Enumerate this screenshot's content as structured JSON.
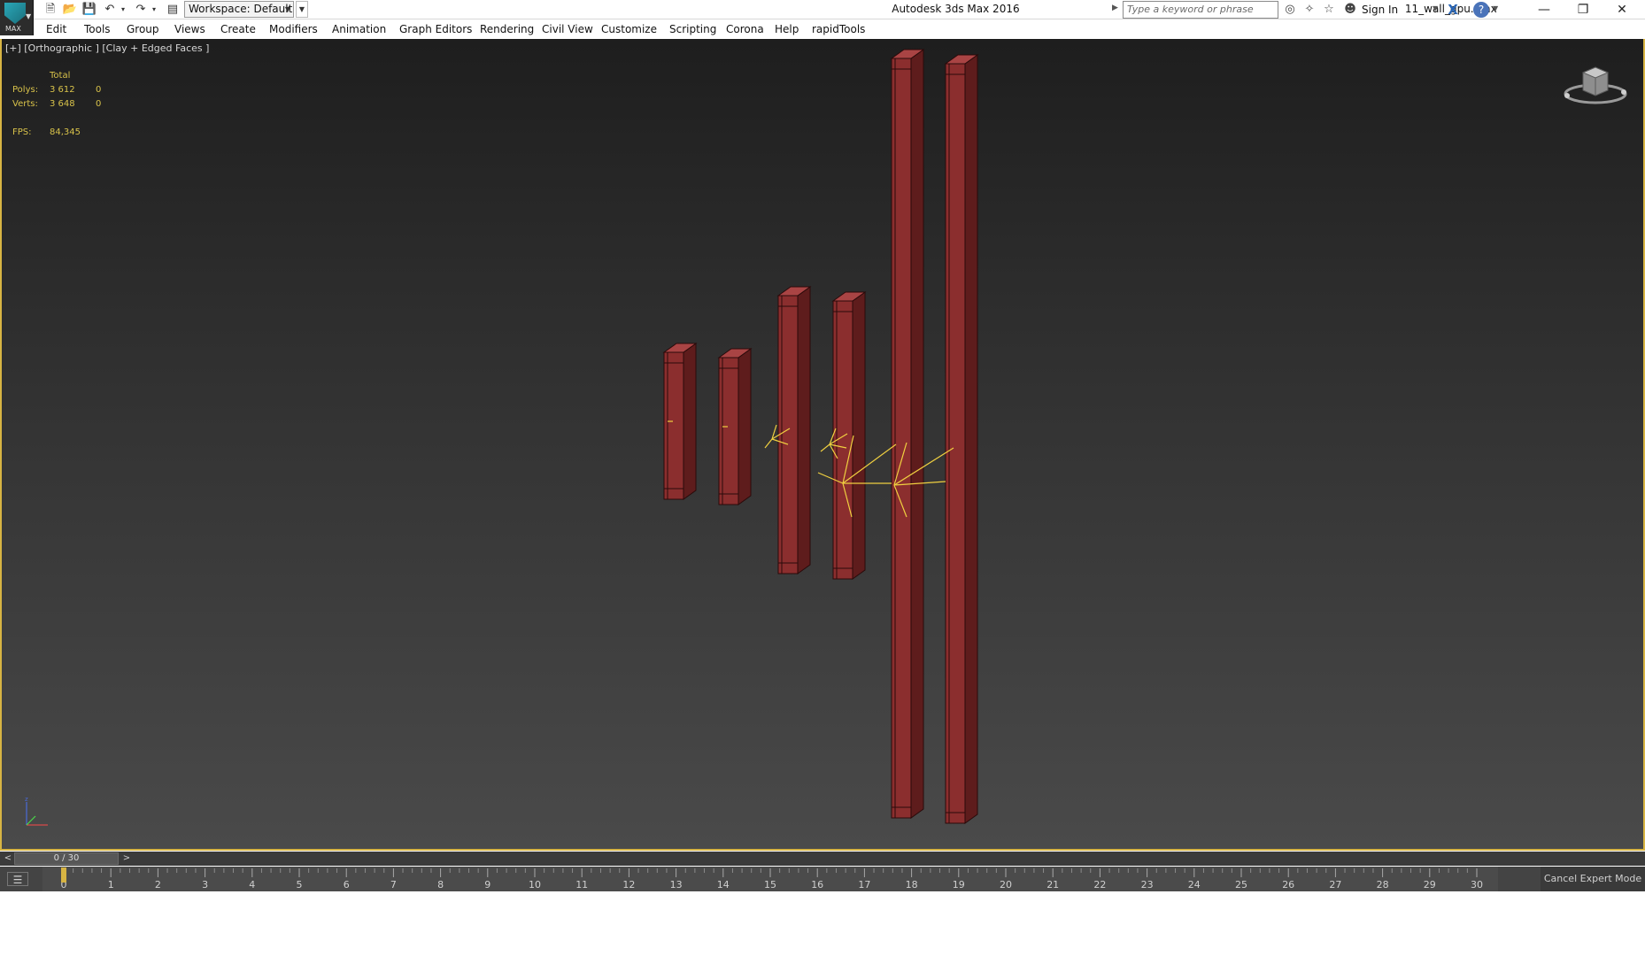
{
  "app": {
    "logo_text": "MAX",
    "title": "Autodesk 3ds Max 2016",
    "filename": "11_wall_gpu.max"
  },
  "quick_access": {
    "workspace": "Workspace: Default"
  },
  "search": {
    "placeholder": "Type a keyword or phrase"
  },
  "account": {
    "sign_in": "Sign In"
  },
  "menu": [
    "Edit",
    "Tools",
    "Group",
    "Views",
    "Create",
    "Modifiers",
    "Animation",
    "Graph Editors",
    "Rendering",
    "Civil View",
    "Customize",
    "Scripting",
    "Corona",
    "Help",
    "rapidTools"
  ],
  "viewport": {
    "label": "[+] [Orthographic ] [Clay + Edged Faces ]",
    "stats": {
      "header": "Total",
      "polys_label": "Polys:",
      "polys_total": "3 612",
      "polys_sel": "0",
      "verts_label": "Verts:",
      "verts_total": "3 648",
      "verts_sel": "0",
      "fps_label": "FPS:",
      "fps_value": "84,345"
    },
    "colors": {
      "column_front": "#8b2e2e",
      "column_side": "#5e1c1c",
      "column_top": "#a94444",
      "edges": "#2a0a0a",
      "gizmo": "#f0d040",
      "selection_frame": "#d7b443"
    }
  },
  "timeline": {
    "prev": "<",
    "slider_label": "0 / 30",
    "next": ">",
    "current_frame": 0,
    "frame_min": 0,
    "frame_max": 30,
    "ticks": [
      "0",
      "1",
      "2",
      "3",
      "4",
      "5",
      "6",
      "7",
      "8",
      "9",
      "10",
      "11",
      "12",
      "13",
      "14",
      "15",
      "16",
      "17",
      "18",
      "19",
      "20",
      "21",
      "22",
      "23",
      "24",
      "25",
      "26",
      "27",
      "28",
      "29",
      "30"
    ]
  },
  "status": {
    "expert_mode": "Cancel Expert Mode"
  }
}
